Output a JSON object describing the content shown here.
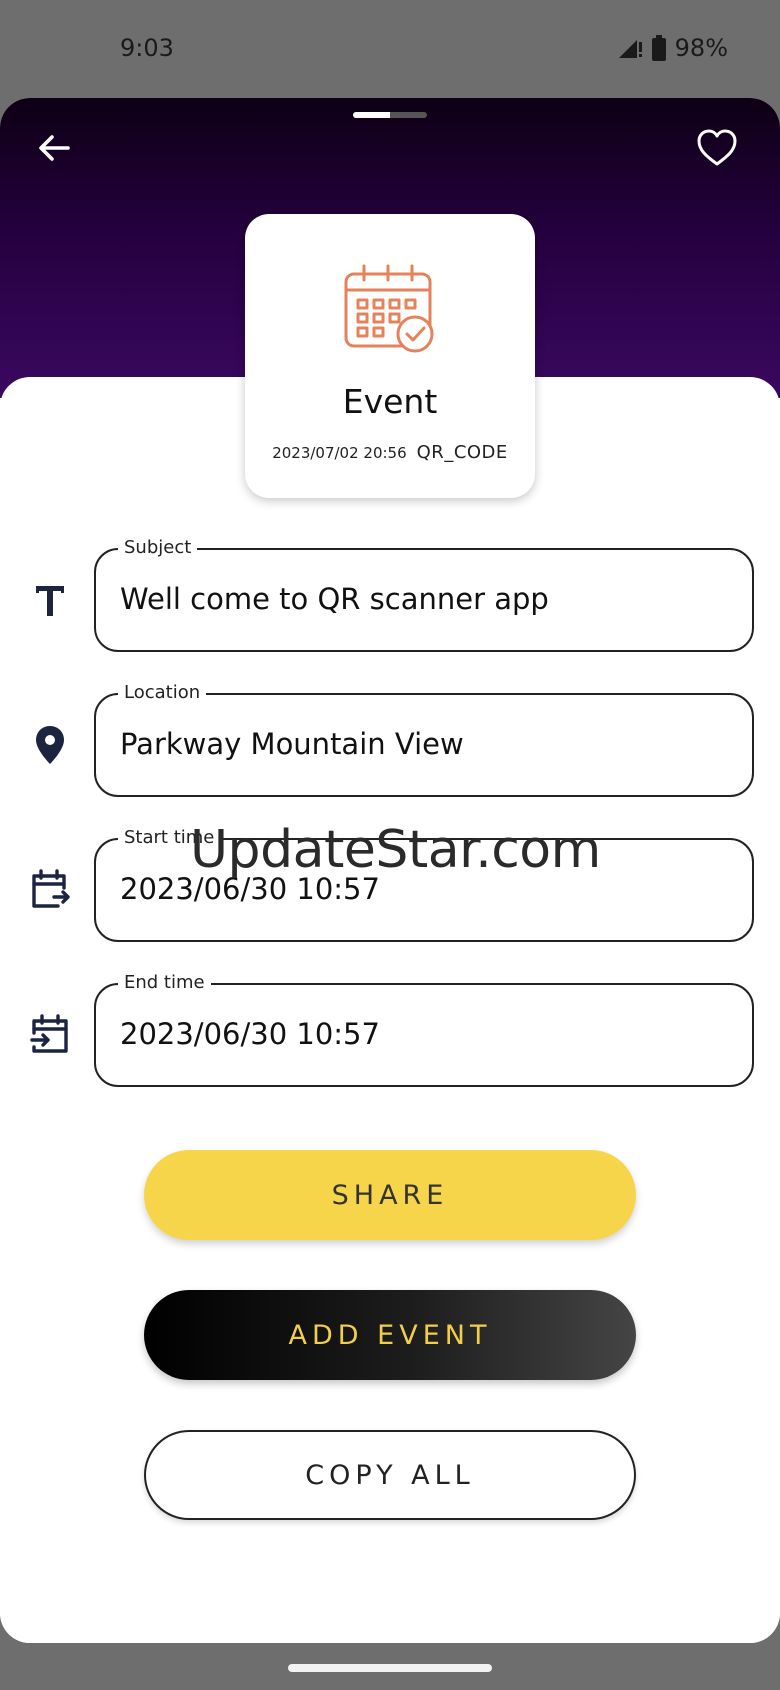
{
  "status_bar": {
    "time": "9:03",
    "battery": "98%"
  },
  "header": {
    "back_icon": "arrow-left-icon",
    "favorite_icon": "heart-icon"
  },
  "type_card": {
    "icon": "calendar-check-icon",
    "title": "Event",
    "date": "2023/07/02 20:56",
    "format": "QR_CODE",
    "icon_color": "#e5825a"
  },
  "fields": {
    "subject": {
      "label": "Subject",
      "value": "Well come to QR scanner app",
      "icon": "text-icon"
    },
    "location": {
      "label": "Location",
      "value": "Parkway Mountain View",
      "icon": "location-pin-icon"
    },
    "start_time": {
      "label": "Start time",
      "value": "2023/06/30 10:57",
      "icon": "calendar-export-icon"
    },
    "end_time": {
      "label": "End time",
      "value": "2023/06/30 10:57",
      "icon": "calendar-import-icon"
    }
  },
  "watermark": "UpdateStar.com",
  "buttons": {
    "share": "SHARE",
    "add_event": "ADD EVENT",
    "copy_all": "COPY ALL"
  },
  "colors": {
    "accent_yellow": "#f7d54a",
    "header_purple": "#3a0860",
    "icon_navy": "#1c2440"
  }
}
